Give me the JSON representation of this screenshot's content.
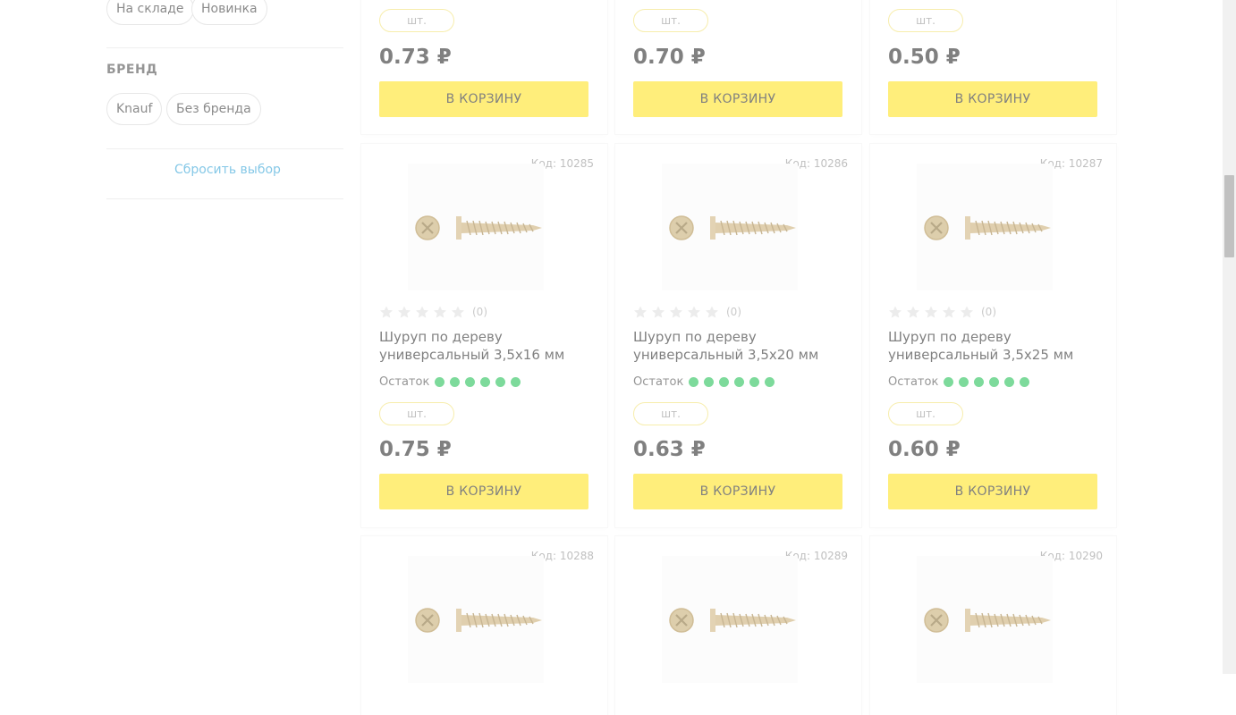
{
  "filters": {
    "availability_chips": [
      "На складе",
      "Новинка"
    ],
    "brand_title": "БРЕНД",
    "brand_chips": [
      "Knauf",
      "Без бренда"
    ],
    "reset_label": "Сбросить выбор"
  },
  "common": {
    "unit": "шт.",
    "cart_label": "В КОРЗИНУ",
    "stock_label": "Остаток",
    "rating_count": "(0)",
    "currency": "₽"
  },
  "colors": {
    "accent": "#ffe42a",
    "stock": "#2ec45e",
    "link": "#3aa6d8"
  },
  "products_top": [
    {
      "price": "0.73 ₽"
    },
    {
      "price": "0.70 ₽"
    },
    {
      "price": "0.50 ₽"
    }
  ],
  "products_mid": [
    {
      "code": "Код: 10285",
      "name": "Шуруп по дереву универсальный 3,5х16 мм",
      "price": "0.75 ₽",
      "rating": 0,
      "stock_level": 6
    },
    {
      "code": "Код: 10286",
      "name": "Шуруп по дереву универсальный 3,5х20 мм",
      "price": "0.63 ₽",
      "rating": 0,
      "stock_level": 6
    },
    {
      "code": "Код: 10287",
      "name": "Шуруп по дереву универсальный 3,5х25 мм",
      "price": "0.60 ₽",
      "rating": 0,
      "stock_level": 6
    }
  ],
  "products_bottom": [
    {
      "code": "Код: 10288"
    },
    {
      "code": "Код: 10289"
    },
    {
      "code": "Код: 10290"
    }
  ]
}
